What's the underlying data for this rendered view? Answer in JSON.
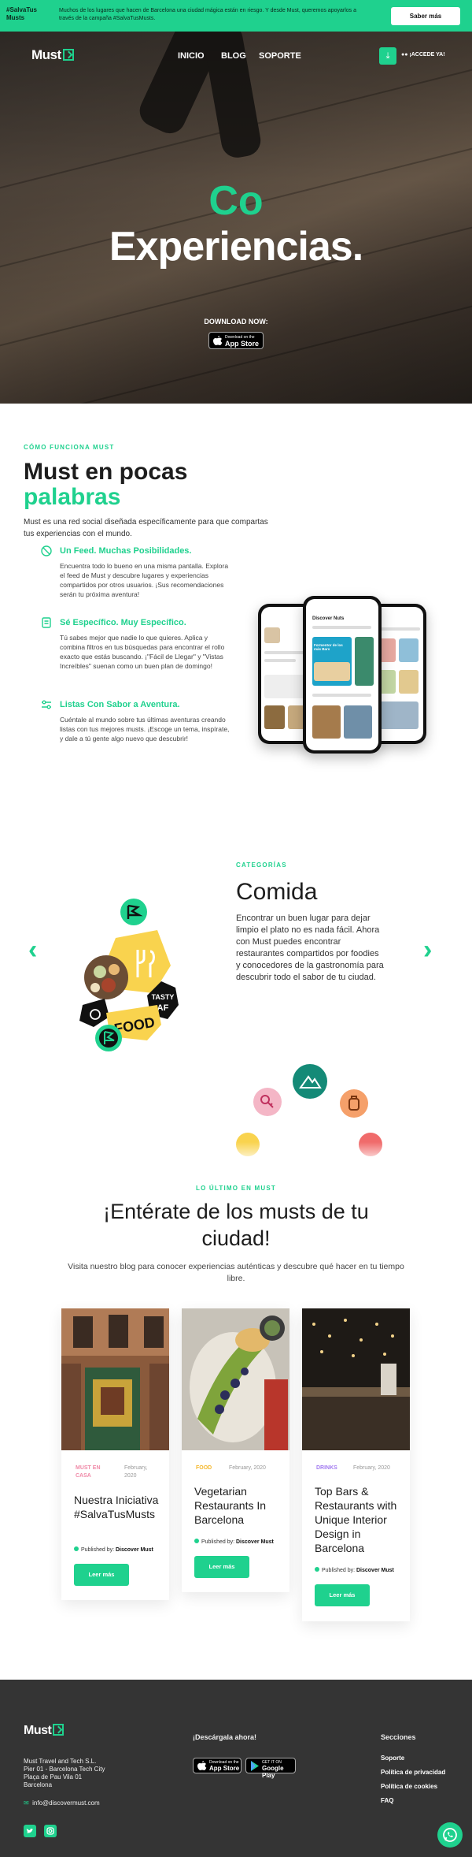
{
  "banner": {
    "tag": "#SalvaTus Musts",
    "text": "Muchos de los lugares que hacen de Barcelona una ciudad mágica están en riesgo. Y desde Must, queremos apoyarlos a través de la campaña #SalvaTusMusts.",
    "button": "Saber más"
  },
  "header": {
    "logo": "Must",
    "nav": [
      "INICIO",
      "BLOG",
      "SOPORTE"
    ],
    "access": "¡ACCEDE YA!"
  },
  "hero": {
    "line1": "Co",
    "line2": "Experiencias.",
    "download_label": "DOWNLOAD NOW:",
    "appstore_small": "Download on the",
    "appstore_big": "App Store"
  },
  "how": {
    "eyebrow": "CÓMO FUNCIONA MUST",
    "title": "Must en pocas",
    "title_green": "palabras",
    "intro": "Must es una red social diseñada específicamente para que compartas tus experiencias con el mundo.",
    "features": [
      {
        "title": "Un Feed. Muchas Posibilidades.",
        "icon": "target-icon",
        "text": "Encuentra todo lo bueno en una misma pantalla. Explora el feed de Must y descubre lugares y experiencias compartidos por otros usuarios. ¡Sus recomendaciones serán tu próxima aventura!"
      },
      {
        "title": "Sé Específico. Muy Específico.",
        "icon": "filter-icon",
        "text": "Tú sabes mejor que nadie lo que quieres. Aplica y combina filtros en tus búsquedas para encontrar el rollo exacto que estás buscando. ¡\"Fácil de Llegar\" y \"Vistas Increíbles\" suenan como un buen plan de domingo!"
      },
      {
        "title": "Listas Con Sabor a Aventura.",
        "icon": "list-icon",
        "text": "Cuéntale al mundo sobre tus últimas aventuras creando listas con tus mejores musts. ¡Escoge un tema, inspírate, y dale a tú gente algo nuevo que descubrir!"
      }
    ],
    "phone_screen_title": "Discover Nuts",
    "phone_card_title": "Formentor de los más Bars"
  },
  "categories": {
    "eyebrow": "CATEGORÍAS",
    "title": "Comida",
    "text": "Encontrar un buen lugar para dejar limpio el plato no es nada fácil. Ahora con Must puedes encontrar restaurantes compartidos por foodies y conocedores de la gastronomía para descubrir todo el sabor de tu ciudad.",
    "sticker_food": "FOOD",
    "sticker_tasty": "TASTY AF"
  },
  "blog": {
    "eyebrow": "LO ÚLTIMO EN MUST",
    "title": "¡Entérate de los musts de tu ciudad!",
    "subtitle": "Visita nuestro blog para conocer experiencias auténticas y descubre qué hacer en tu tiempo libre.",
    "cards": [
      {
        "category": "MUST EN CASA",
        "date": "February, 2020",
        "title": "Nuestra Iniciativa #SalvaTusMusts",
        "published": "Published by:",
        "author": "Discover Must",
        "button": "Leer más",
        "cat_color": "#f08aa8"
      },
      {
        "category": "FOOD",
        "date": "February, 2020",
        "title": "Vegetarian Restaurants In Barcelona",
        "published": "Published by:",
        "author": "Discover Must",
        "button": "Leer más",
        "cat_color": "#f5b82e"
      },
      {
        "category": "DRINKS",
        "date": "February, 2020",
        "title": "Top Bars & Restaurants with Unique Interior Design in Barcelona",
        "published": "Published by:",
        "author": "Discover Must",
        "button": "Leer más",
        "cat_color": "#a37cf0"
      }
    ]
  },
  "footer": {
    "logo": "Must",
    "address": [
      "Must Travel and Tech S.L.",
      "Pier 01 - Barcelona Tech City",
      "Plaça de Pau Vila 01",
      "Barcelona"
    ],
    "email": "info@discovermust.com",
    "download_title": "¡Descárgala ahora!",
    "appstore_small": "Download on the",
    "appstore_big": "App Store",
    "googleplay_small": "GET IT ON",
    "googleplay_big": "Google Play",
    "sections_title": "Secciones",
    "links": [
      "Soporte",
      "Política de privacidad",
      "Política de cookies",
      "FAQ"
    ]
  },
  "colors": {
    "accent": "#1fd18e",
    "footer_bg": "#343434",
    "text_dark": "#1d1d1d"
  }
}
